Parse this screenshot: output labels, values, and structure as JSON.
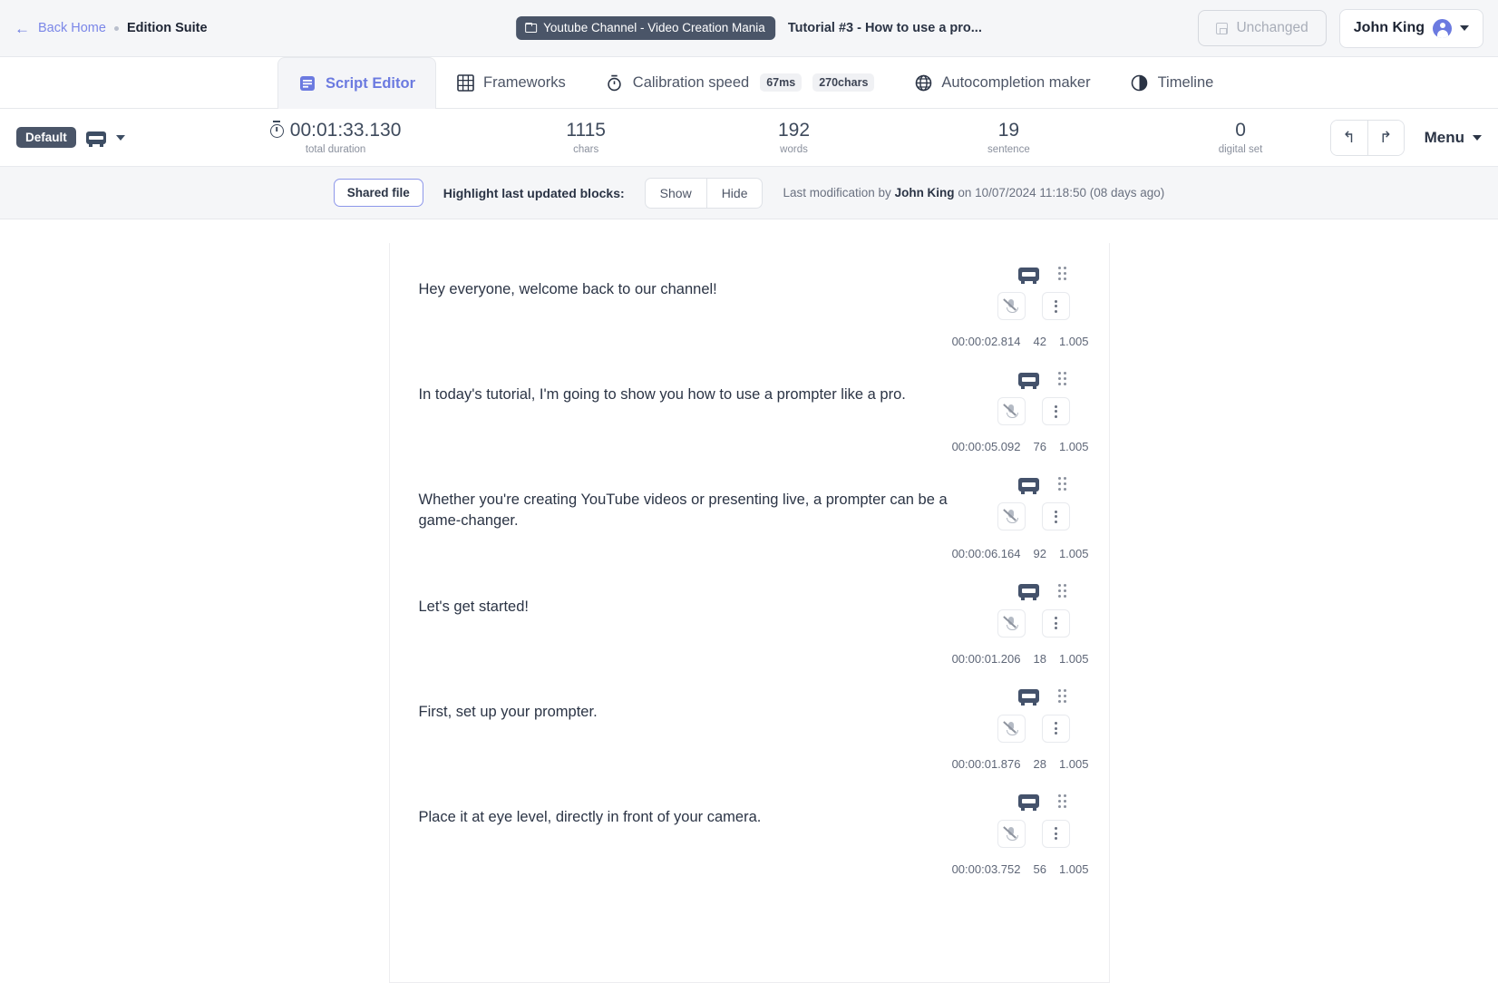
{
  "topbar": {
    "back_label": "Back Home",
    "app_name": "Edition Suite",
    "project_chip": "Youtube Channel - Video Creation Mania",
    "document_title": "Tutorial #3 - How to use a pro...",
    "save_status": "Unchanged",
    "user_name": "John King"
  },
  "tabs": [
    {
      "label": "Script Editor",
      "icon": "script-icon",
      "active": true,
      "badges": []
    },
    {
      "label": "Frameworks",
      "icon": "grid-icon",
      "active": false,
      "badges": []
    },
    {
      "label": "Calibration speed",
      "icon": "stopwatch-icon",
      "active": false,
      "badges": [
        "67ms",
        "270chars"
      ]
    },
    {
      "label": "Autocompletion maker",
      "icon": "globe-icon",
      "active": false,
      "badges": []
    },
    {
      "label": "Timeline",
      "icon": "timeline-icon",
      "active": false,
      "badges": []
    }
  ],
  "stats": {
    "preset_label": "Default",
    "duration_value": "00:01:33.130",
    "duration_label": "total duration",
    "items": [
      {
        "value": "1115",
        "label": "chars"
      },
      {
        "value": "192",
        "label": "words"
      },
      {
        "value": "19",
        "label": "sentence"
      },
      {
        "value": "0",
        "label": "digital set"
      }
    ],
    "menu_label": "Menu"
  },
  "subbar": {
    "shared_file_label": "Shared file",
    "highlight_label": "Highlight last updated blocks:",
    "show_label": "Show",
    "hide_label": "Hide",
    "last_modification_prefix": "Last modification by",
    "last_modification_user": "John King",
    "last_modification_suffix": "on 10/07/2024 11:18:50 (08 days ago)"
  },
  "blocks": [
    {
      "text": "Hey everyone, welcome back to our channel!",
      "time": "00:00:02.814",
      "chars": "42",
      "speed": "1.005"
    },
    {
      "text": "In today's tutorial, I'm going to show you how to use a prompter like a pro.",
      "time": "00:00:05.092",
      "chars": "76",
      "speed": "1.005"
    },
    {
      "text": "Whether you're creating YouTube videos or presenting live, a prompter can be a game-changer.",
      "time": "00:00:06.164",
      "chars": "92",
      "speed": "1.005"
    },
    {
      "text": "Let's get started!",
      "time": "00:00:01.206",
      "chars": "18",
      "speed": "1.005"
    },
    {
      "text": "First, set up your prompter.",
      "time": "00:00:01.876",
      "chars": "28",
      "speed": "1.005"
    },
    {
      "text": "Place it at eye level, directly in front of your camera.",
      "time": "00:00:03.752",
      "chars": "56",
      "speed": "1.005"
    }
  ],
  "colors": {
    "accent": "#6b7ae0",
    "dark_slate": "#4a5568",
    "text": "#2b3445",
    "muted": "#8a909d"
  }
}
